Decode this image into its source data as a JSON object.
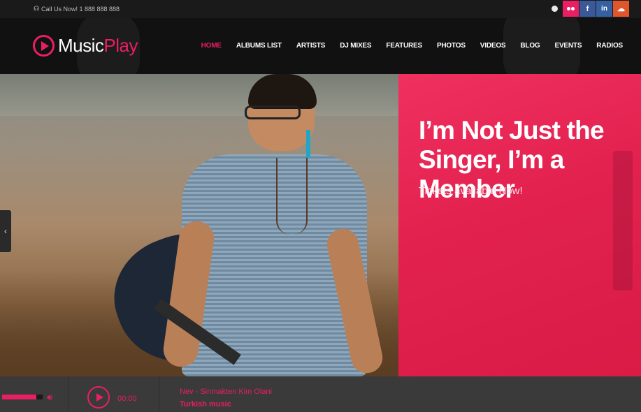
{
  "topbar": {
    "call_text": "Call Us Now! 1 888 888 888",
    "phone_icon": "headset-icon",
    "socials": [
      {
        "name": "share-icon"
      },
      {
        "name": "flickr-icon"
      },
      {
        "name": "facebook-icon",
        "label": "f"
      },
      {
        "name": "linkedin-icon",
        "label": "in"
      },
      {
        "name": "soundcloud-icon"
      }
    ]
  },
  "header": {
    "logo_part1": "Music",
    "logo_part2": "Play",
    "nav": [
      "HOME",
      "ALBUMS LIST",
      "ARTISTS",
      "DJ MIXES",
      "FEATURES",
      "PHOTOS",
      "VIDEOS",
      "BLOG",
      "EVENTS",
      "RADIOS"
    ],
    "active_index": 0
  },
  "hero": {
    "title": "I’m Not Just the Singer, I’m a Member",
    "subtitle": "Tickets available Now!",
    "prev_arrow": "‹"
  },
  "player": {
    "volume_percent": 85,
    "time": "00:00",
    "track_title": "Nev - Sinmakten Kim Olani",
    "track_subtitle": "Turkish music"
  },
  "colors": {
    "accent": "#e91e63",
    "panel": "#e2214f"
  }
}
